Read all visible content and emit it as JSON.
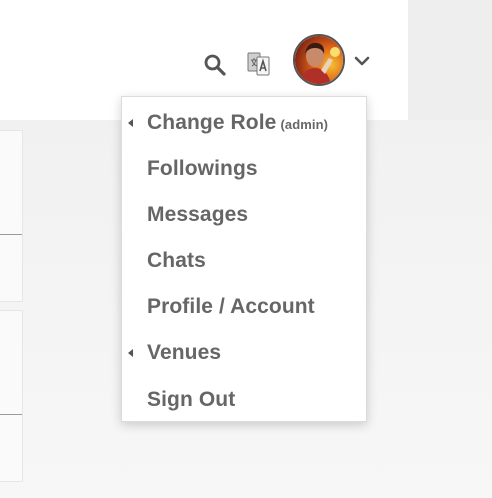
{
  "header": {
    "icons": {
      "search": "search-icon",
      "translate": "translate-icon",
      "avatar": "user-avatar",
      "chevron": "chevron-down-icon"
    }
  },
  "menu": {
    "items": [
      {
        "label": "Change Role",
        "suffix": "(admin)",
        "submenu": true
      },
      {
        "label": "Followings",
        "submenu": false
      },
      {
        "label": "Messages",
        "submenu": false
      },
      {
        "label": "Chats",
        "submenu": false
      },
      {
        "label": "Profile / Account",
        "submenu": false
      },
      {
        "label": "Venues",
        "submenu": true
      },
      {
        "label": "Sign Out",
        "submenu": false
      }
    ]
  },
  "colors": {
    "menu_text": "#666666",
    "icon": "#555555",
    "menu_bg": "#ffffff",
    "page_bg": "#f4f4f4"
  }
}
